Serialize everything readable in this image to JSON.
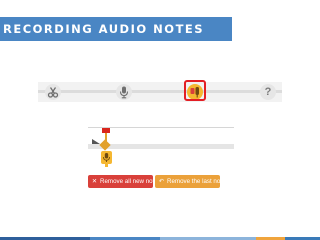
{
  "slide": {
    "title": "RECORDING AUDIO NOTES"
  },
  "toolbar": {
    "tools": [
      {
        "icon": "scissors-icon"
      },
      {
        "icon": "microphone-icon"
      },
      {
        "icon": "audio-notes-icon",
        "selected": true
      },
      {
        "icon": "help-icon",
        "glyph": "?"
      }
    ]
  },
  "recorder": {
    "buttons": {
      "remove_all": {
        "icon": "close-icon",
        "glyph": "✕",
        "label": "Remove all new notes"
      },
      "remove_last": {
        "icon": "undo-icon",
        "glyph": "↶",
        "label": "Remove the last note"
      }
    }
  },
  "colors": {
    "banner": "#4a86c4",
    "highlight": "#e31e24",
    "marker": "#f5b731",
    "remove_all_button": "#d9403a",
    "remove_last_button": "#eba13a",
    "bottom_bar": [
      "#2e5f9b",
      "#4a86c4",
      "#8cb4db",
      "#f0a43c",
      "#3a7ab8"
    ]
  }
}
